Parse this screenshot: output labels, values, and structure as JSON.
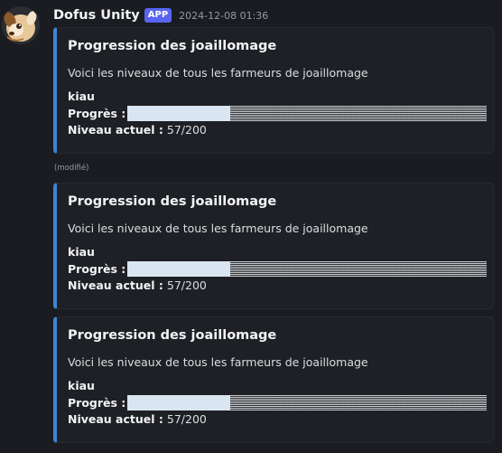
{
  "message": {
    "author": "Dofus Unity",
    "badge": "APP",
    "timestamp": "2024-12-08 01:36",
    "edited_label": "(modifié)"
  },
  "colors": {
    "accent_bar": "#3a86d0",
    "badge_bg": "#5865f2",
    "background": "#1b1c21",
    "embed_bg": "#1f2025"
  },
  "embeds": [
    {
      "title": "Progression des joaillomage",
      "description": "Voici les niveaux de tous les farmeurs de joaillomage",
      "player": "kiau",
      "progress_label": "Progrès :",
      "progress_fraction": 0.285,
      "level_label": "Niveau actuel :",
      "level_value": "57/200"
    },
    {
      "title": "Progression des joaillomage",
      "description": "Voici les niveaux de tous les farmeurs de joaillomage",
      "player": "kiau",
      "progress_label": "Progrès :",
      "progress_fraction": 0.285,
      "level_label": "Niveau actuel :",
      "level_value": "57/200"
    },
    {
      "title": "Progression des joaillomage",
      "description": "Voici les niveaux de tous les farmeurs de joaillomage",
      "player": "kiau",
      "progress_label": "Progrès :",
      "progress_fraction": 0.285,
      "level_label": "Niveau actuel :",
      "level_value": "57/200"
    }
  ]
}
